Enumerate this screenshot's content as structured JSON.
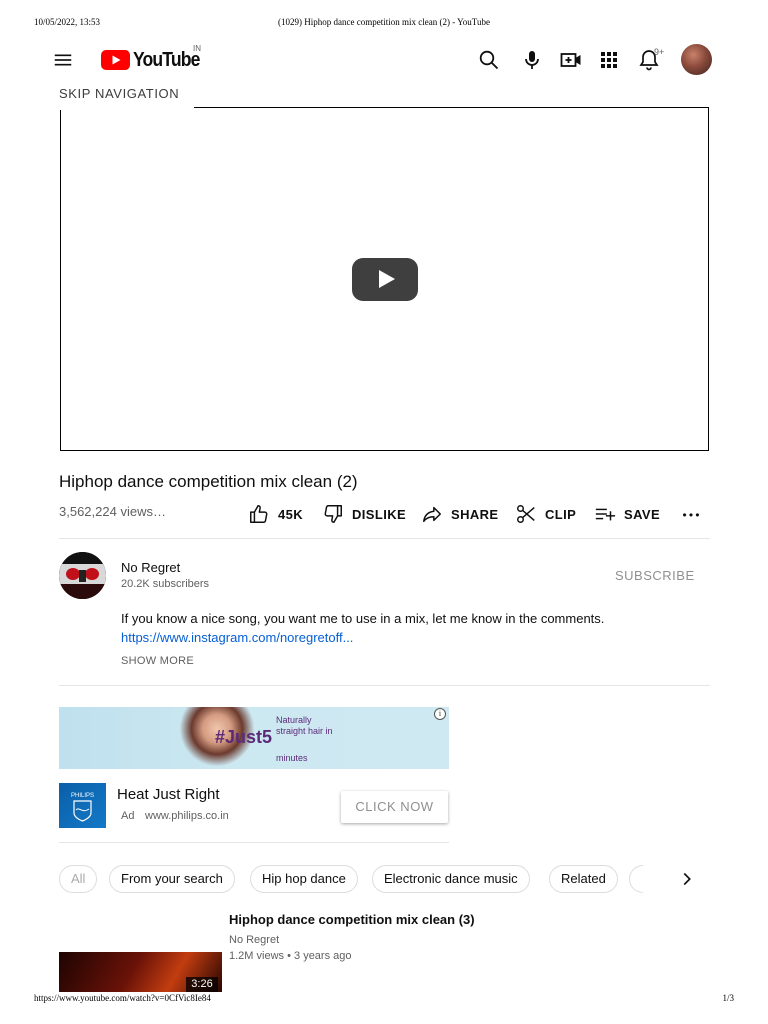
{
  "print": {
    "datetime": "10/05/2022, 13:53",
    "page_title": "(1029) Hiphop dance competition mix clean (2) - YouTube",
    "url": "https://www.youtube.com/watch?v=0CfVic8Ie84",
    "page_number": "1/3"
  },
  "masthead": {
    "logo_text": "YouTube",
    "country_code": "IN",
    "notifications_count": "9+",
    "icons": [
      "menu-icon",
      "search-icon",
      "microphone-icon",
      "create-video-icon",
      "apps-grid-icon",
      "bell-icon"
    ]
  },
  "skip_navigation": "SKIP NAVIGATION",
  "video": {
    "title": "Hiphop dance competition mix clean (2)",
    "views": "3,562,224 views…",
    "actions": {
      "like": "45K",
      "dislike": "DISLIKE",
      "share": "SHARE",
      "clip": "CLIP",
      "save": "SAVE"
    }
  },
  "owner": {
    "name": "No Regret",
    "subscribers": "20.2K subscribers",
    "subscribe_label": "SUBSCRIBE"
  },
  "description": {
    "text": "If you know a nice song, you want me to use in a mix, let me know in the comments.",
    "link": "https://www.instagram.com/noregretoff...",
    "show_more": "SHOW MORE"
  },
  "ad": {
    "banner_line1": "Naturally",
    "banner_line2": "straight hair in",
    "banner_hashtag": "#Just5",
    "banner_line3": "minutes",
    "brand_logo_text": "PHILIPS",
    "title": "Heat Just Right",
    "badge": "Ad",
    "domain": "www.philips.co.in",
    "cta": "CLICK NOW",
    "info_symbol": "i"
  },
  "chips": [
    "All",
    "From your search",
    "Hip hop dance",
    "Electronic dance music",
    "Related"
  ],
  "related": {
    "title": "Hiphop dance competition mix clean (3)",
    "channel": "No Regret",
    "views": "1.2M views",
    "separator": "•",
    "age": "3 years ago",
    "duration": "3:26"
  },
  "colors": {
    "youtube_red": "#ff0000",
    "link_blue": "#065fd4",
    "secondary_text": "#606060",
    "ad_purple": "#5b2b7a"
  }
}
